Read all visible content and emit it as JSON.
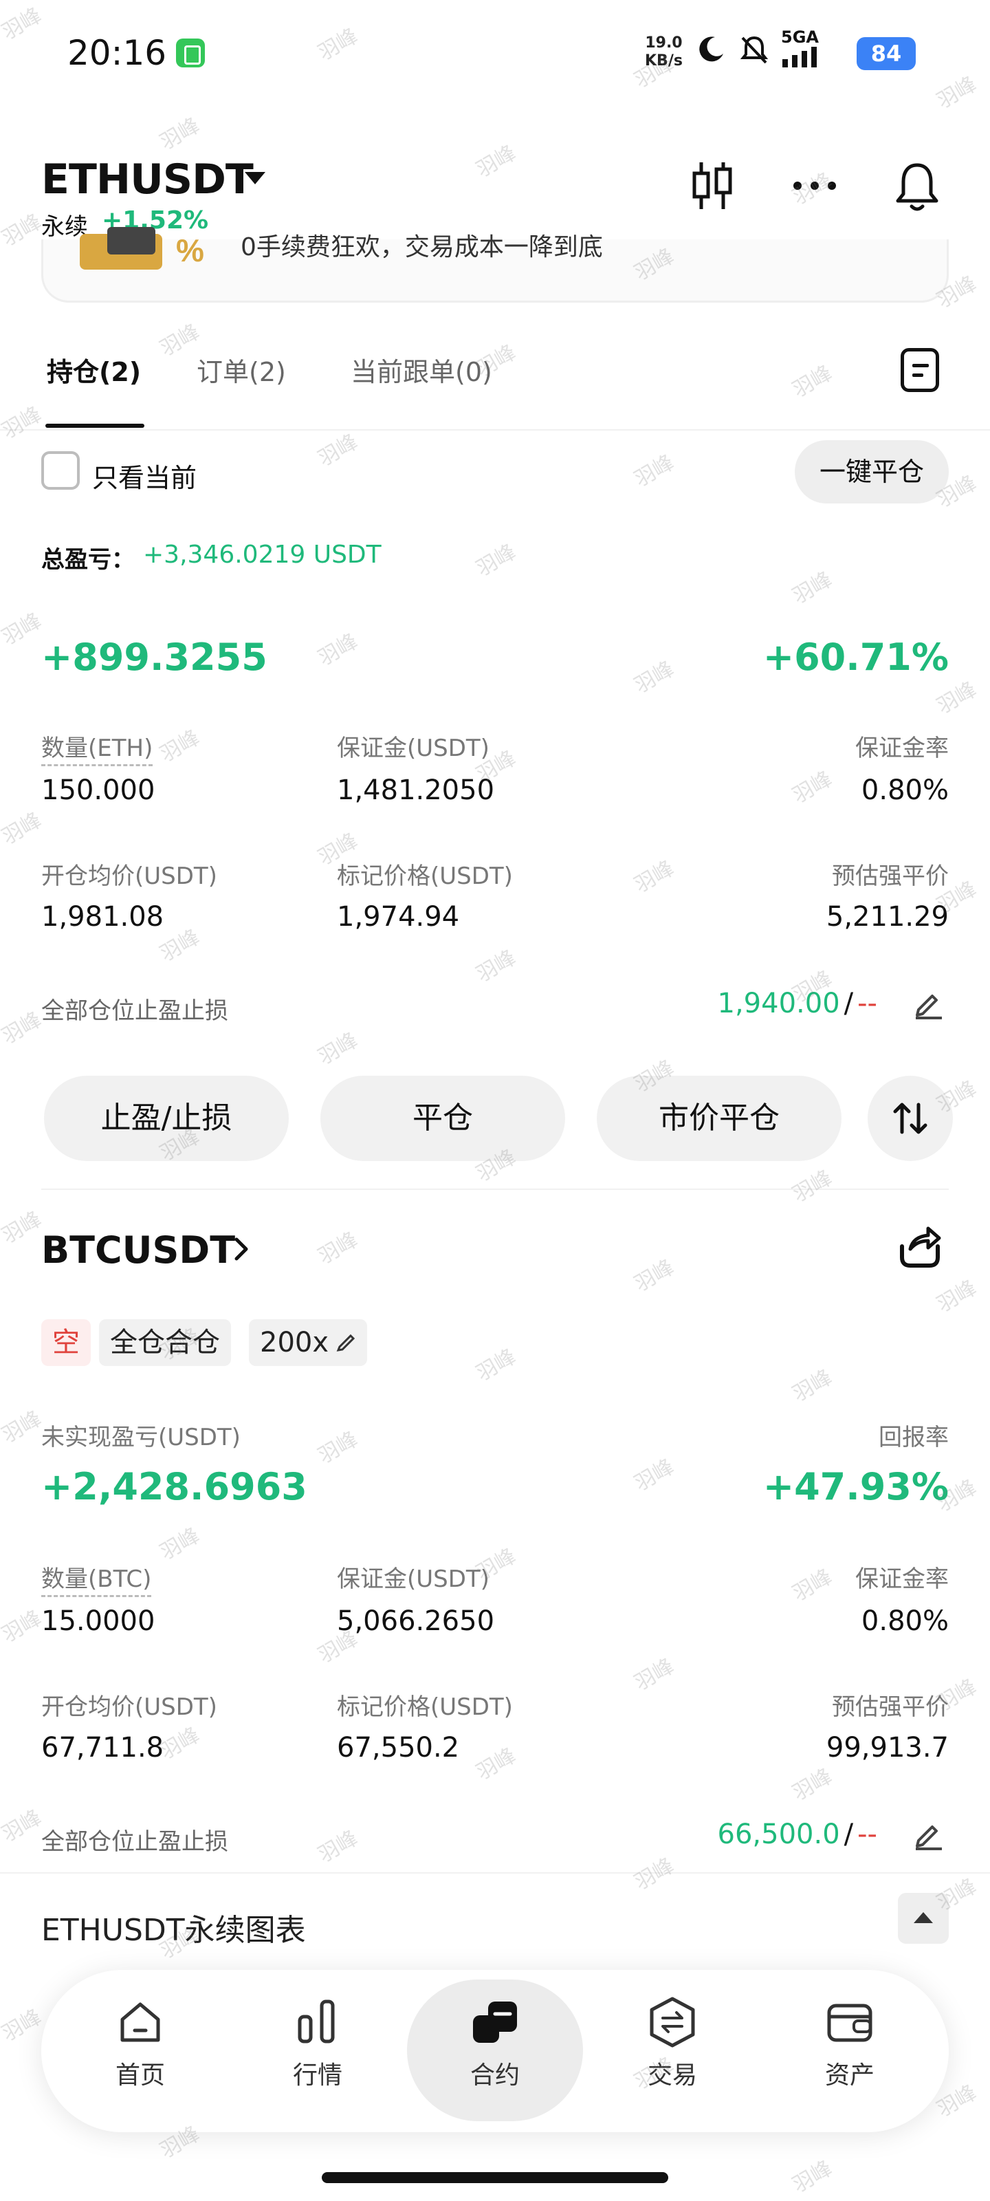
{
  "status_bar": {
    "time": "20:16",
    "net_speed_value": "19.0",
    "net_speed_unit": "KB/s",
    "network": "5GA",
    "battery": "84"
  },
  "header": {
    "symbol": "ETHUSDT",
    "contract_type": "永续",
    "change": "+1.52%"
  },
  "banner": {
    "text": "0手续费狂欢，交易成本一降到底"
  },
  "tabs": [
    {
      "label": "持仓(2)"
    },
    {
      "label": "订单(2)"
    },
    {
      "label": "当前跟单(0)"
    }
  ],
  "filter": {
    "only_current_label": "只看当前",
    "close_all_label": "一键平仓",
    "total_pnl_label": "总盈亏：",
    "total_pnl_value": "+3,346.0219 USDT"
  },
  "positions": [
    {
      "pnl_value": "+899.3255",
      "roe_value": "+60.71%",
      "qty_label": "数量(ETH)",
      "qty_value": "150.000",
      "margin_label": "保证金(USDT)",
      "margin_value": "1,481.2050",
      "margin_ratio_label": "保证金率",
      "margin_ratio_value": "0.80%",
      "entry_label": "开仓均价(USDT)",
      "entry_value": "1,981.08",
      "mark_label": "标记价格(USDT)",
      "mark_value": "1,974.94",
      "liq_label": "预估强平价",
      "liq_value": "5,211.29",
      "tpsl_label": "全部仓位止盈止损",
      "tp_value": "1,940.00",
      "separator": "/",
      "sl_value": "--",
      "actions": [
        "止盈/止损",
        "平仓",
        "市价平仓"
      ]
    },
    {
      "symbol": "BTCUSDT",
      "side_tag": "空",
      "mode_tag": "全仓合仓",
      "leverage_tag": "200x",
      "pnl_label": "未实现盈亏(USDT)",
      "pnl_value": "+2,428.6963",
      "roe_label": "回报率",
      "roe_value": "+47.93%",
      "qty_label": "数量(BTC)",
      "qty_value": "15.0000",
      "margin_label": "保证金(USDT)",
      "margin_value": "5,066.2650",
      "margin_ratio_label": "保证金率",
      "margin_ratio_value": "0.80%",
      "entry_label": "开仓均价(USDT)",
      "entry_value": "67,711.8",
      "mark_label": "标记价格(USDT)",
      "mark_value": "67,550.2",
      "liq_label": "预估强平价",
      "liq_value": "99,913.7",
      "tpsl_label": "全部仓位止盈止损",
      "tp_value": "66,500.0",
      "separator": "/",
      "sl_value": "--"
    }
  ],
  "chart_section": {
    "title": "ETHUSDT永续图表"
  },
  "bottom_nav": [
    {
      "label": "首页"
    },
    {
      "label": "行情"
    },
    {
      "label": "合约"
    },
    {
      "label": "交易"
    },
    {
      "label": "资产"
    }
  ],
  "watermark_text": "羽峰",
  "colors": {
    "profit_green": "#1fb97b",
    "loss_red": "#e0433d",
    "button_grey": "#f1f1f1",
    "status_blue": "#3b82f6"
  }
}
